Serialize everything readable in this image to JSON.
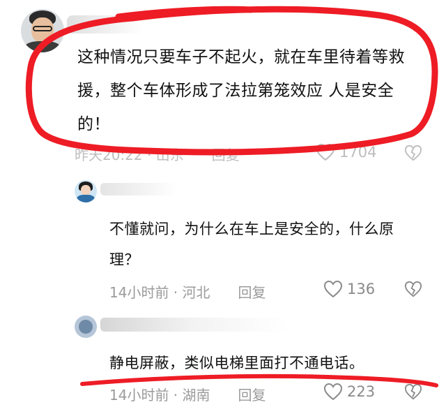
{
  "comments": [
    {
      "text": "这种情况只要车子不起火，就在车里待着等救援，整个车体形成了法拉第笼效应 人是安全的！",
      "time": "昨天20:22",
      "location": "山东",
      "reply_label": "回复",
      "likes": "1704"
    },
    {
      "text": "不懂就问，为什么在车上是安全的，什么原理？",
      "time": "14小时前",
      "location": "河北",
      "reply_label": "回复",
      "likes": "136"
    },
    {
      "text": "静电屏蔽，类似电梯里面打不通电话。",
      "time": "14小时前",
      "location": "湖南",
      "reply_label": "回复",
      "likes": "223"
    }
  ],
  "separator": " · ",
  "colors": {
    "annotation_red": "#ee1c25",
    "meta_gray": "#9a9a9a"
  },
  "icons": [
    "heart-icon",
    "broken-heart-icon"
  ]
}
